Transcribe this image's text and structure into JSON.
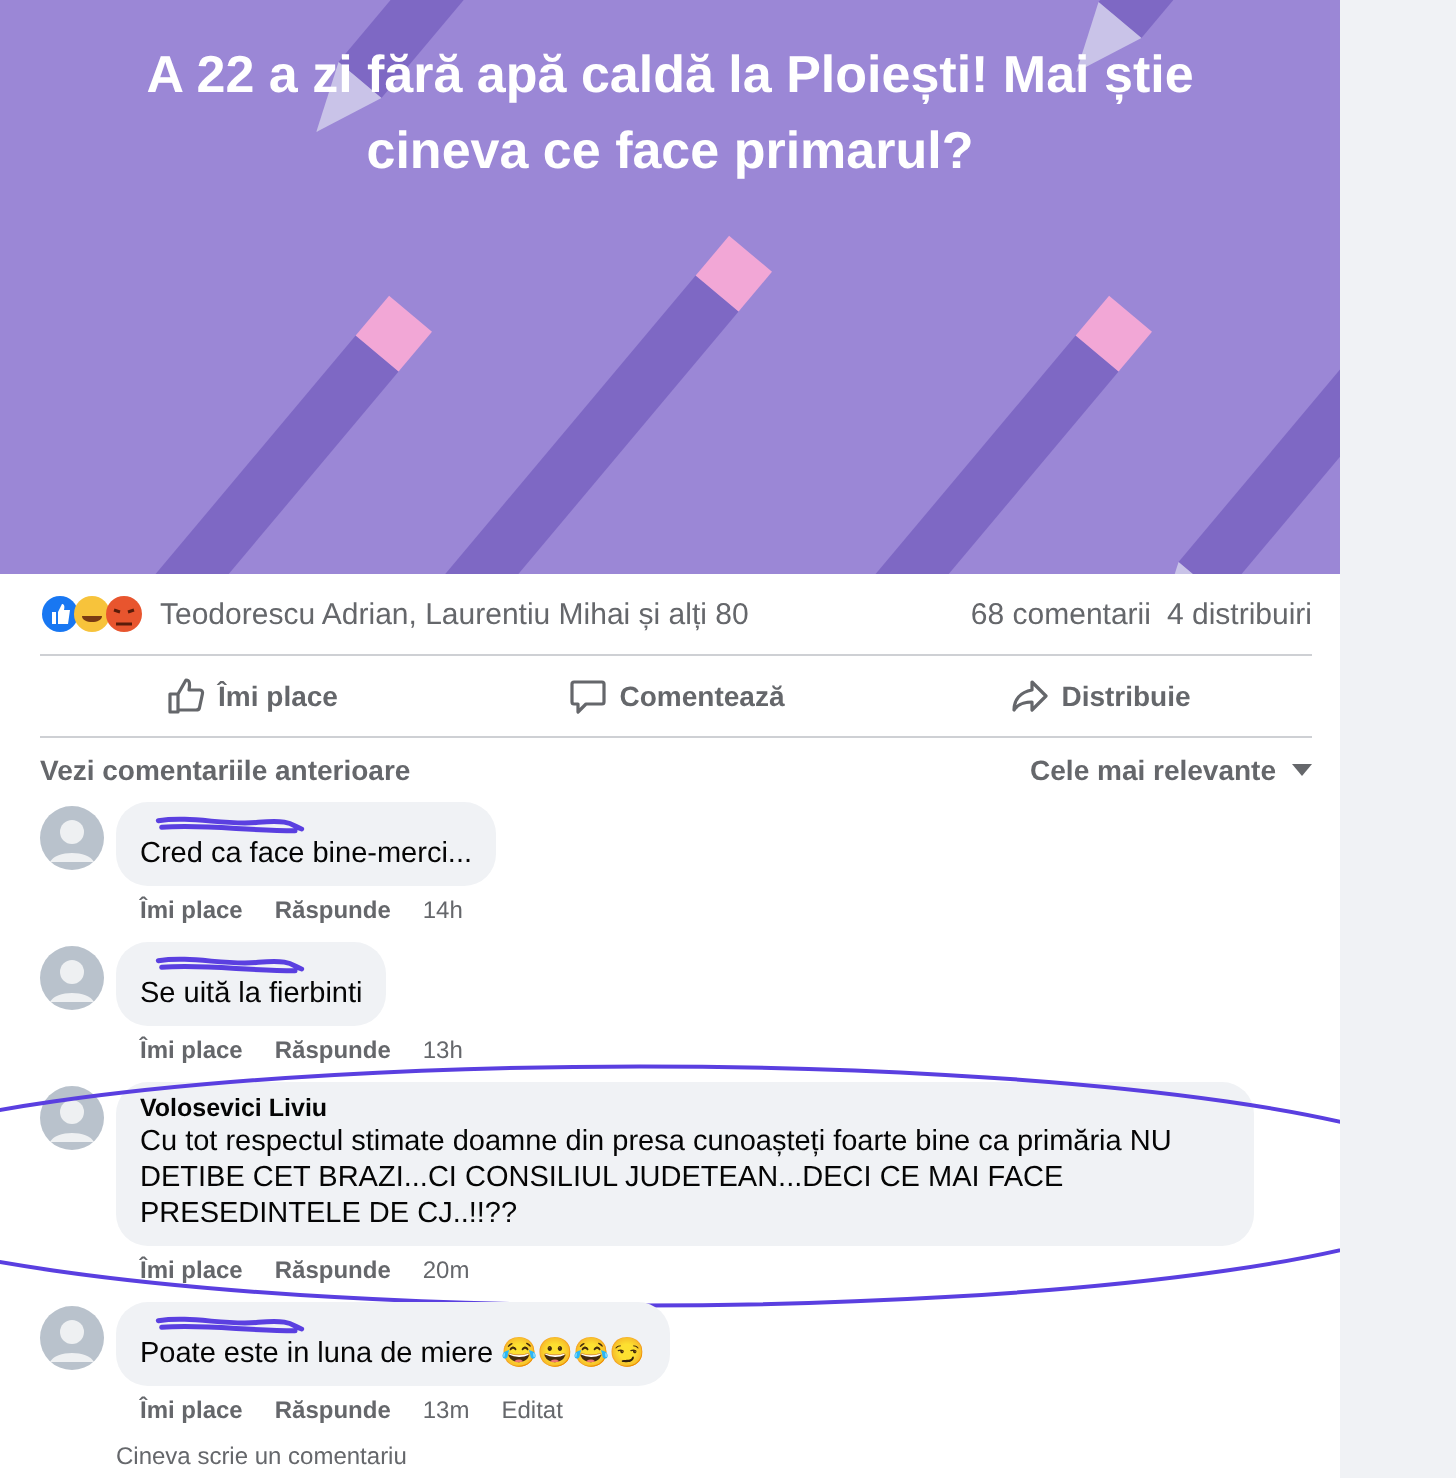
{
  "post": {
    "title": "A 22 a zi fără apă caldă la Ploiești! Mai știe cineva ce face primarul?"
  },
  "reactions": {
    "names": "Teodorescu Adrian, Laurentiu Mihai și alți 80",
    "comments": "68 comentarii",
    "shares": "4 distribuiri"
  },
  "actions": [
    {
      "kind": "like",
      "label": "Îmi place"
    },
    {
      "kind": "comment",
      "label": "Comentează"
    },
    {
      "kind": "share",
      "label": "Distribuie"
    }
  ],
  "comments_header": {
    "previous": "Vezi comentariile anterioare",
    "sort": "Cele mai relevante"
  },
  "comments": [
    {
      "name_hidden": true,
      "text": "Cred ca face bine-merci...",
      "like": "Îmi place",
      "reply": "Răspunde",
      "time": "14h"
    },
    {
      "name_hidden": true,
      "text": "Se uită la fierbinti",
      "like": "Îmi place",
      "reply": "Răspunde",
      "time": "13h"
    },
    {
      "name_hidden": false,
      "name": "Volosevici Liviu",
      "text": "Cu tot respectul stimate doamne din presa cunoașteți foarte bine ca primăria NU DETIBE CET BRAZI...CI CONSILIUL JUDETEAN...DECI CE MAI FACE PRESEDINTELE DE CJ..!!??",
      "like": "Îmi place",
      "reply": "Răspunde",
      "time": "20m",
      "highlighted": true
    },
    {
      "name_hidden": true,
      "text": "Poate este in luna de miere 😂😀😂😏",
      "like": "Îmi place",
      "reply": "Răspunde",
      "time": "13m",
      "edited": "Editat"
    }
  ],
  "typing": "Cineva scrie un comentariu"
}
